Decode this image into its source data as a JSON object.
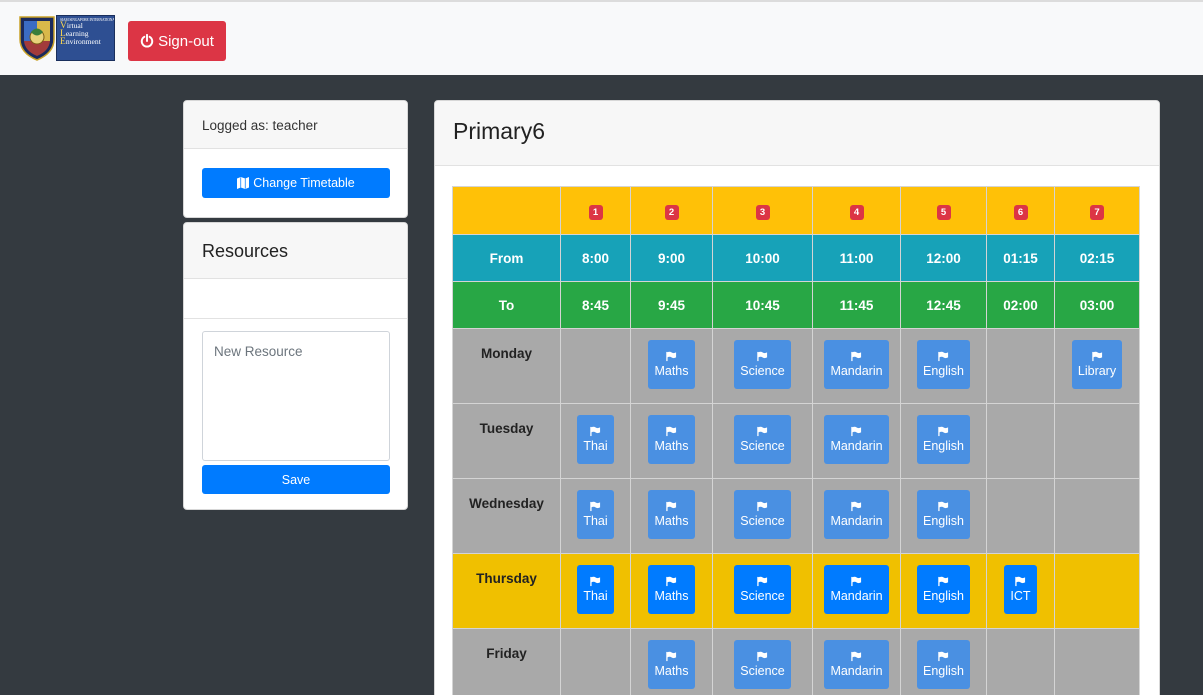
{
  "navbar": {
    "logo_top_text": "SIAM SINGAPORE INTERNATIONAL SCHOOL",
    "logo_lines": [
      {
        "first": "V",
        "rest": "irtual"
      },
      {
        "first": "L",
        "rest": "earning"
      },
      {
        "first": "E",
        "rest": "nvironment"
      }
    ],
    "signout_label": "Sign-out"
  },
  "login_card": {
    "logged_as": "Logged as: teacher",
    "change_timetable_label": "Change Timetable"
  },
  "resources_card": {
    "title": "Resources",
    "input_placeholder": "New Resource",
    "save_label": "Save"
  },
  "main": {
    "title": "Primary6"
  },
  "timetable": {
    "periods": [
      "1",
      "2",
      "3",
      "4",
      "5",
      "6",
      "7"
    ],
    "from_label": "From",
    "to_label": "To",
    "from": [
      "8:00",
      "9:00",
      "10:00",
      "11:00",
      "12:00",
      "01:15",
      "02:15"
    ],
    "to": [
      "8:45",
      "9:45",
      "10:45",
      "11:45",
      "12:45",
      "02:00",
      "03:00"
    ],
    "days": [
      {
        "name": "Monday",
        "highlight": false,
        "lessons": [
          "",
          "Maths",
          "Science",
          "Mandarin",
          "English",
          "",
          "Library"
        ]
      },
      {
        "name": "Tuesday",
        "highlight": false,
        "lessons": [
          "Thai",
          "Maths",
          "Science",
          "Mandarin",
          "English",
          "",
          ""
        ]
      },
      {
        "name": "Wednesday",
        "highlight": false,
        "lessons": [
          "Thai",
          "Maths",
          "Science",
          "Mandarin",
          "English",
          "",
          ""
        ]
      },
      {
        "name": "Thursday",
        "highlight": true,
        "lessons": [
          "Thai",
          "Maths",
          "Science",
          "Mandarin",
          "English",
          "ICT",
          ""
        ]
      },
      {
        "name": "Friday",
        "highlight": false,
        "lessons": [
          "",
          "Maths",
          "Science",
          "Mandarin",
          "English",
          "",
          ""
        ]
      }
    ]
  },
  "colors": {
    "danger": "#dc3545",
    "primary": "#007bff",
    "lesson_blue": "#4a90e2",
    "warning": "#ffc107",
    "info": "#17a2b8",
    "success": "#28a745",
    "day_gray": "#a9a9a9",
    "today_yellow": "#f0c000",
    "background": "#343a40"
  },
  "icons": {
    "signout": "power-icon",
    "change_timetable": "map-icon",
    "lesson": "flag-icon"
  }
}
